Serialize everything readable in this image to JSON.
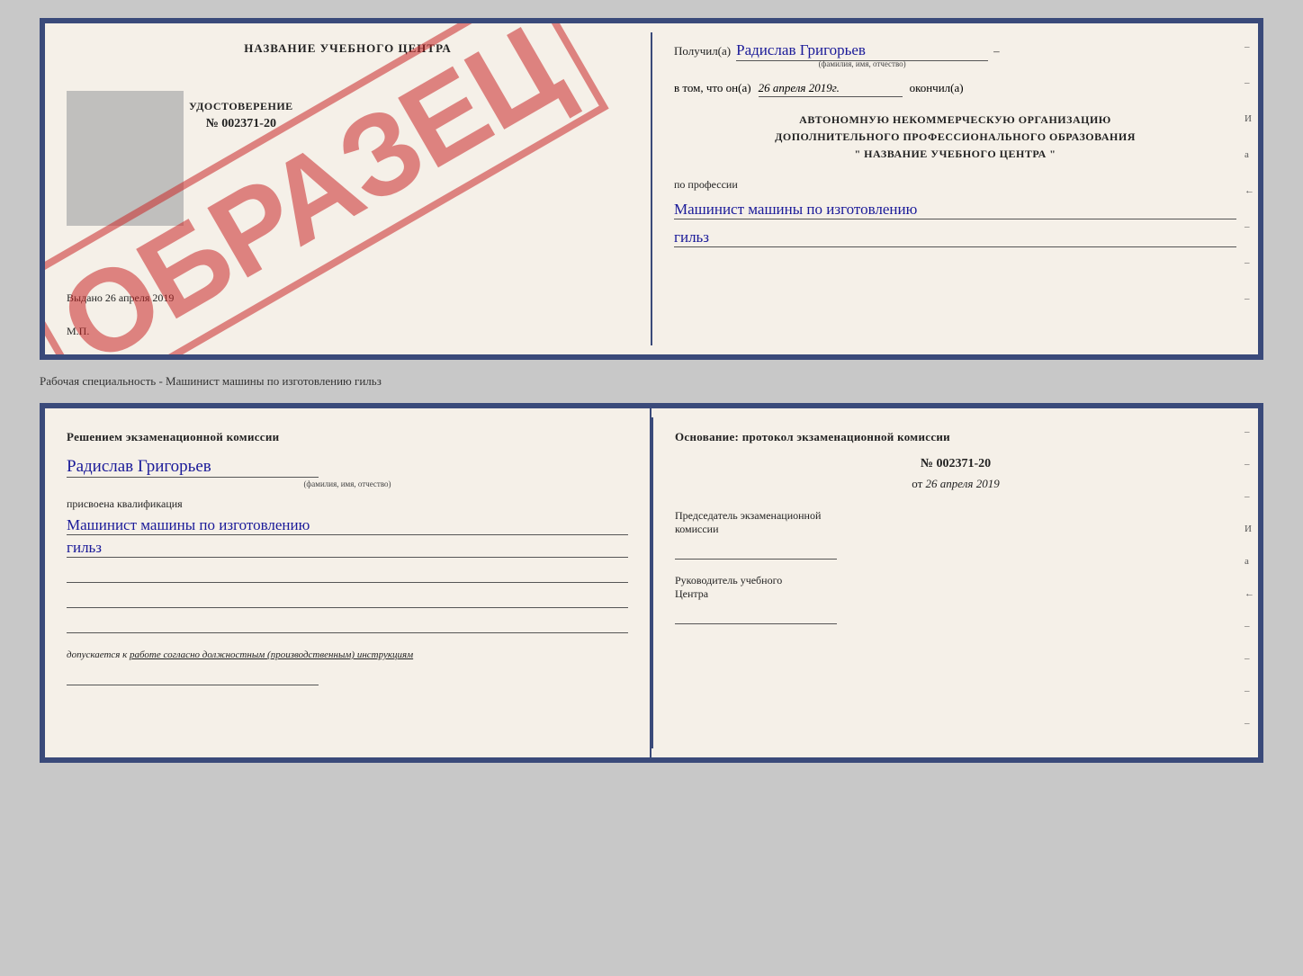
{
  "top_doc": {
    "left": {
      "title": "НАЗВАНИЕ УЧЕБНОГО ЦЕНТРА",
      "watermark": "ОБРАЗЕЦ",
      "cert_type": "УДОСТОВЕРЕНИЕ",
      "cert_number": "№ 002371-20",
      "issued_label": "Выдано",
      "issued_date": "26 апреля 2019",
      "mp_label": "М.П."
    },
    "right": {
      "received_label": "Получил(а)",
      "received_name": "Радислав Григорьев",
      "name_sublabel": "(фамилия, имя, отчество)",
      "in_that_label": "в том, что он(а)",
      "completion_date": "26 апреля 2019г.",
      "completed_label": "окончил(а)",
      "org_line1": "АВТОНОМНУЮ НЕКОММЕРЧЕСКУЮ ОРГАНИЗАЦИЮ",
      "org_line2": "ДОПОЛНИТЕЛЬНОГО ПРОФЕССИОНАЛЬНОГО ОБРАЗОВАНИЯ",
      "org_line3": "\"  НАЗВАНИЕ УЧЕБНОГО ЦЕНТРА  \"",
      "profession_label": "по профессии",
      "profession_line1": "Машинист машины по изготовлению",
      "profession_line2": "гильз"
    }
  },
  "separator": {
    "text": "Рабочая специальность - Машинист машины по изготовлению гильз"
  },
  "bottom_doc": {
    "left": {
      "title": "Решением  экзаменационной  комиссии",
      "name": "Радислав Григорьев",
      "name_sublabel": "(фамилия, имя, отчество)",
      "assigned_label": "присвоена квалификация",
      "qual_line1": "Машинист машины по изготовлению",
      "qual_line2": "гильз",
      "admits_prefix": "допускается к",
      "admits_text": "работе согласно должностным (производственным) инструкциям"
    },
    "right": {
      "basis_label": "Основание: протокол экзаменационной комиссии",
      "number": "№  002371-20",
      "date_prefix": "от",
      "date_value": "26 апреля 2019",
      "chairman_label": "Председатель экзаменационной",
      "chairman_label2": "комиссии",
      "director_label": "Руководитель учебного",
      "director_label2": "Центра"
    },
    "right_edge": {
      "marks": [
        "–",
        "–",
        "–",
        "И",
        "а",
        "←",
        "–",
        "–",
        "–",
        "–"
      ]
    }
  }
}
